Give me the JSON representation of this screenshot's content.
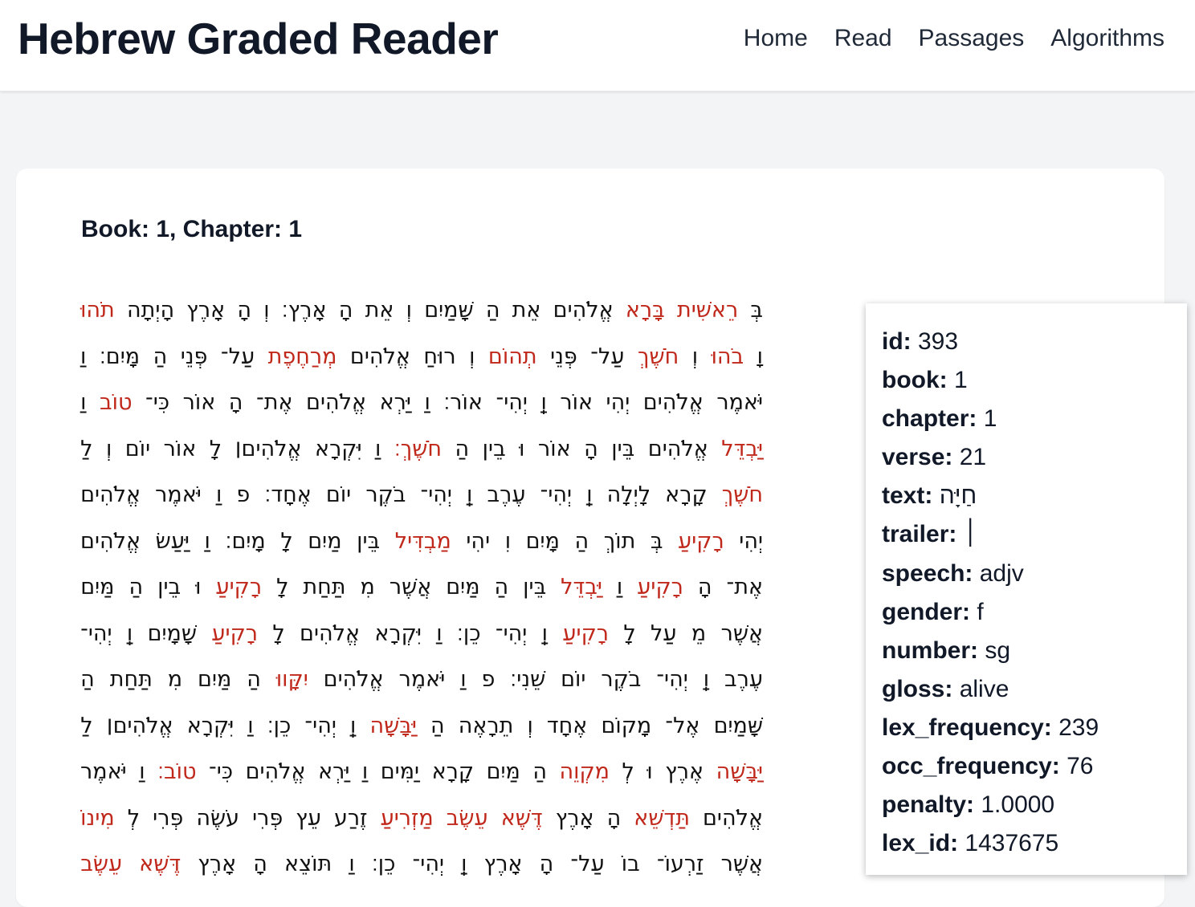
{
  "header": {
    "title": "Hebrew Graded Reader",
    "nav": [
      "Home",
      "Read",
      "Passages",
      "Algorithms"
    ]
  },
  "content": {
    "heading": "Book: 1, Chapter: 1",
    "lines": [
      [
        [
          "בְּ",
          0
        ],
        [
          "רֵאשִׁית",
          1
        ],
        [
          "בָּרָא",
          1
        ],
        [
          "אֱלֹהִים",
          0
        ],
        [
          "אֵת",
          0
        ],
        [
          "הַ",
          0
        ],
        [
          "שָּׁמַיִם",
          0
        ],
        [
          "וְ",
          0
        ],
        [
          "אֵת",
          0
        ],
        [
          "הָ",
          0
        ],
        [
          "אָרֶץ׃",
          0
        ],
        [
          "וְ",
          0
        ],
        [
          "הָ",
          0
        ],
        [
          "אָרֶץ",
          0
        ],
        [
          "הָיְתָה",
          0
        ],
        [
          "תֹהוּ",
          1
        ]
      ],
      [
        [
          "וָ",
          0
        ],
        [
          "בֹהוּ",
          1
        ],
        [
          "וְ",
          0
        ],
        [
          "חֹשֶׁךְ",
          1
        ],
        [
          "עַל־",
          0
        ],
        [
          "פְּנֵי",
          0
        ],
        [
          "תְהוֹם",
          1
        ],
        [
          "וְ",
          0
        ],
        [
          "רוּחַ",
          0
        ],
        [
          "אֱלֹהִים",
          0
        ],
        [
          "מְרַחֶפֶת",
          1
        ],
        [
          "עַל־",
          0
        ],
        [
          "פְּנֵי",
          0
        ],
        [
          "הַ",
          0
        ],
        [
          "מָּיִם׃",
          0
        ],
        [
          "וַ",
          0
        ]
      ],
      [
        [
          "יֹּאמֶר",
          0
        ],
        [
          "אֱלֹהִים",
          0
        ],
        [
          "יְהִי",
          0
        ],
        [
          "אוֹר",
          0
        ],
        [
          "וַֽ",
          0
        ],
        [
          "יְהִי־",
          0
        ],
        [
          "אוֹר׃",
          0
        ],
        [
          "וַ",
          0
        ],
        [
          "יַּרְא",
          0
        ],
        [
          "אֱלֹהִים",
          0
        ],
        [
          "אֶת־",
          0
        ],
        [
          "הָ",
          0
        ],
        [
          "אוֹר",
          0
        ],
        [
          "כִּי־",
          0
        ],
        [
          "טוֹב",
          1
        ],
        [
          "וַ",
          0
        ]
      ],
      [
        [
          "יַּבְדֵּל",
          1
        ],
        [
          "אֱלֹהִים",
          0
        ],
        [
          "בֵּין",
          0
        ],
        [
          "הָ",
          0
        ],
        [
          "אוֹר",
          0
        ],
        [
          "וּ",
          0
        ],
        [
          "בֵין",
          0
        ],
        [
          "הַ",
          0
        ],
        [
          "חֹשֶׁךְ׃",
          1
        ],
        [
          "וַ",
          0
        ],
        [
          "יִּקְרָא",
          0
        ],
        [
          "אֱלֹהִים׀",
          0
        ],
        [
          "לָ",
          0
        ],
        [
          "אוֹר",
          0
        ],
        [
          "יוֹם",
          0
        ],
        [
          "וְ",
          0
        ],
        [
          "לַ",
          0
        ]
      ],
      [
        [
          "חֹשֶׁךְ",
          1
        ],
        [
          "קָרָא",
          0
        ],
        [
          "לָיְלָה",
          0
        ],
        [
          "וַֽ",
          0
        ],
        [
          "יְהִי־",
          0
        ],
        [
          "עֶרֶב",
          0
        ],
        [
          "וַֽ",
          0
        ],
        [
          "יְהִי־",
          0
        ],
        [
          "בֹקֶר",
          0
        ],
        [
          "יוֹם",
          0
        ],
        [
          "אֶחָד׃",
          0
        ],
        [
          "פ",
          0
        ],
        [
          "וַ",
          0
        ],
        [
          "יֹּאמֶר",
          0
        ],
        [
          "אֱלֹהִים",
          0
        ]
      ],
      [
        [
          "יְהִי",
          0
        ],
        [
          "רָקִיעַ",
          1
        ],
        [
          "בְּ",
          0
        ],
        [
          "תוֹךְ",
          0
        ],
        [
          "הַ",
          0
        ],
        [
          "מָּיִם",
          0
        ],
        [
          "וִ",
          0
        ],
        [
          "יהִי",
          0
        ],
        [
          "מַבְדִּיל",
          1
        ],
        [
          "בֵּין",
          0
        ],
        [
          "מַיִם",
          0
        ],
        [
          "לָ",
          0
        ],
        [
          "מָיִם׃",
          0
        ],
        [
          "וַ",
          0
        ],
        [
          "יַּעַשׂ",
          0
        ],
        [
          "אֱלֹהִים",
          0
        ]
      ],
      [
        [
          "אֶת־",
          0
        ],
        [
          "הָ",
          0
        ],
        [
          "רָקִיעַ",
          1
        ],
        [
          "וַ",
          0
        ],
        [
          "יַּבְדֵּל",
          1
        ],
        [
          "בֵּין",
          0
        ],
        [
          "הַ",
          0
        ],
        [
          "מַּיִם",
          0
        ],
        [
          "אֲשֶׁר",
          0
        ],
        [
          "מִ",
          0
        ],
        [
          "תַּחַת",
          0
        ],
        [
          "לָ",
          0
        ],
        [
          "רָקִיעַ",
          1
        ],
        [
          "וּ",
          0
        ],
        [
          "בֵין",
          0
        ],
        [
          "הַ",
          0
        ],
        [
          "מַּיִם",
          0
        ]
      ],
      [
        [
          "אֲשֶׁר",
          0
        ],
        [
          "מֵ",
          0
        ],
        [
          "עַל",
          0
        ],
        [
          "לָ",
          0
        ],
        [
          "רָקִיעַ",
          1
        ],
        [
          "וַֽ",
          0
        ],
        [
          "יְהִי־",
          0
        ],
        [
          "כֵן׃",
          0
        ],
        [
          "וַ",
          0
        ],
        [
          "יִּקְרָא",
          0
        ],
        [
          "אֱלֹהִים",
          0
        ],
        [
          "לָ",
          0
        ],
        [
          "רָקִיעַ",
          1
        ],
        [
          "שָׁמָיִם",
          0
        ],
        [
          "וַֽ",
          0
        ],
        [
          "יְהִי־",
          0
        ]
      ],
      [
        [
          "עֶרֶב",
          0
        ],
        [
          "וַֽ",
          0
        ],
        [
          "יְהִי־",
          0
        ],
        [
          "בֹקֶר",
          0
        ],
        [
          "יוֹם",
          0
        ],
        [
          "שֵׁנִי׃",
          0
        ],
        [
          "פ",
          0
        ],
        [
          "וַ",
          0
        ],
        [
          "יֹּאמֶר",
          0
        ],
        [
          "אֱלֹהִים",
          0
        ],
        [
          "יִקָּווּ",
          1
        ],
        [
          "הַ",
          0
        ],
        [
          "מַּיִם",
          0
        ],
        [
          "מִ",
          0
        ],
        [
          "תַּחַת",
          0
        ],
        [
          "הַ",
          0
        ]
      ],
      [
        [
          "שָּׁמַיִם",
          0
        ],
        [
          "אֶל־",
          0
        ],
        [
          "מָקוֹם",
          0
        ],
        [
          "אֶחָד",
          0
        ],
        [
          "וְ",
          0
        ],
        [
          "תֵרָאֶה",
          0
        ],
        [
          "הַ",
          0
        ],
        [
          "יַּבָּשָׁה",
          1
        ],
        [
          "וַֽ",
          0
        ],
        [
          "יְהִי־",
          0
        ],
        [
          "כֵן׃",
          0
        ],
        [
          "וַ",
          0
        ],
        [
          "יִּקְרָא",
          0
        ],
        [
          "אֱלֹהִים׀",
          0
        ],
        [
          "לַ",
          0
        ]
      ],
      [
        [
          "יַּבָּשָׁה",
          1
        ],
        [
          "אֶרֶץ",
          0
        ],
        [
          "וּ",
          0
        ],
        [
          "לְ",
          0
        ],
        [
          "מִקְוֵה",
          1
        ],
        [
          "הַ",
          0
        ],
        [
          "מַּיִם",
          0
        ],
        [
          "קָרָא",
          0
        ],
        [
          "יַמִּים",
          0
        ],
        [
          "וַ",
          0
        ],
        [
          "יַּרְא",
          0
        ],
        [
          "אֱלֹהִים",
          0
        ],
        [
          "כִּי־",
          0
        ],
        [
          "טוֹב׃",
          1
        ],
        [
          "וַ",
          0
        ],
        [
          "יֹּאמֶר",
          0
        ]
      ],
      [
        [
          "אֱלֹהִים",
          0
        ],
        [
          "תַּדְשֵׁא",
          1
        ],
        [
          "הָ",
          0
        ],
        [
          "אָרֶץ",
          0
        ],
        [
          "דֶּשֶׁא",
          1
        ],
        [
          "עֵשֶׂב",
          1
        ],
        [
          "מַזְרִיעַ",
          1
        ],
        [
          "זֶרַע",
          0
        ],
        [
          "עֵץ",
          0
        ],
        [
          "פְּרִי",
          0
        ],
        [
          "עֹשֶׂה",
          0
        ],
        [
          "פְּרִי",
          0
        ],
        [
          "לְ",
          0
        ],
        [
          "מִינוֹ",
          1
        ]
      ],
      [
        [
          "אֲשֶׁר",
          0
        ],
        [
          "זַרְעוֹ־",
          0
        ],
        [
          "בוֹ",
          0
        ],
        [
          "עַל־",
          0
        ],
        [
          "הָ",
          0
        ],
        [
          "אָרֶץ",
          0
        ],
        [
          "וַֽ",
          0
        ],
        [
          "יְהִי־",
          0
        ],
        [
          "כֵן׃",
          0
        ],
        [
          "וַ",
          0
        ],
        [
          "תּוֹצֵא",
          0
        ],
        [
          "הָ",
          0
        ],
        [
          "אָרֶץ",
          0
        ],
        [
          "דֶּשֶׁא",
          1
        ],
        [
          "עֵשֶׂב",
          1
        ]
      ]
    ]
  },
  "popup": {
    "fields": [
      {
        "key": "id",
        "value": "393"
      },
      {
        "key": "book",
        "value": "1"
      },
      {
        "key": "chapter",
        "value": "1"
      },
      {
        "key": "verse",
        "value": "21"
      },
      {
        "key": "text",
        "value": "חַיָּה"
      },
      {
        "key": "trailer",
        "value": "׀"
      },
      {
        "key": "speech",
        "value": "adjv"
      },
      {
        "key": "gender",
        "value": "f"
      },
      {
        "key": "number",
        "value": "sg"
      },
      {
        "key": "gloss",
        "value": "alive"
      },
      {
        "key": "lex_frequency",
        "value": "239"
      },
      {
        "key": "occ_frequency",
        "value": "76"
      },
      {
        "key": "penalty",
        "value": "1.0000"
      },
      {
        "key": "lex_id",
        "value": "1437675"
      }
    ]
  },
  "colors": {
    "highlight": "#c0281b",
    "background": "#f3f4f6"
  }
}
